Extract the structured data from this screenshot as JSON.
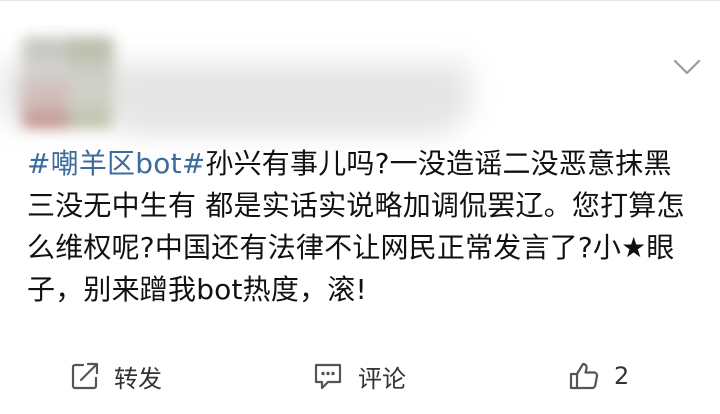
{
  "post": {
    "topic": "#嘲羊区bot#",
    "text": "孙兴有事儿吗?一没造谣二没恶意抹黑三没无中生有 都是实话实说略加调侃罢辽。您打算怎么维权呢?中国还有法律不让网民正常发言了?小★眼子，别来蹭我bot热度，滚!"
  },
  "actions": {
    "forward_label": "转发",
    "comment_label": "评论",
    "like_count": "2"
  },
  "icons": {
    "menu": "chevron-down-icon",
    "forward": "share-icon",
    "comment": "comment-icon",
    "like": "thumbs-up-icon"
  },
  "colors": {
    "topic": "#3c6c9c",
    "text": "#111111",
    "icon": "#555555"
  }
}
